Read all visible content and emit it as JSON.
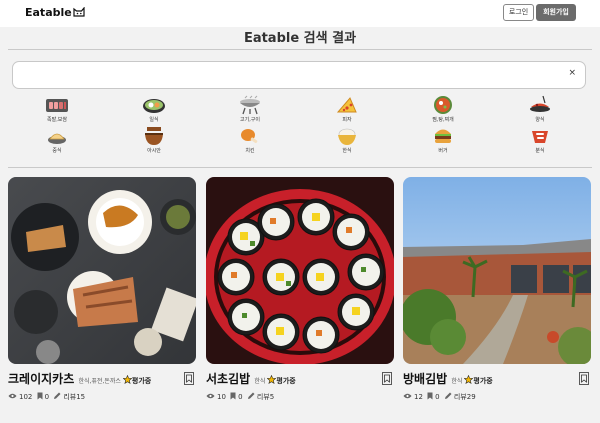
{
  "header": {
    "logo": "Eatable",
    "login_label": "로그인",
    "signup_label": "회원가입"
  },
  "page_title": "Eatable 검색 결과",
  "search": {
    "value": "",
    "placeholder": "",
    "clear_label": "×"
  },
  "categories": [
    {
      "label": "족발,보쌈",
      "icon": "pork-slices-icon"
    },
    {
      "label": "일식",
      "icon": "sushi-icon"
    },
    {
      "label": "고기,구이",
      "icon": "grill-icon"
    },
    {
      "label": "피자",
      "icon": "pizza-icon"
    },
    {
      "label": "찜,탕,찌개",
      "icon": "stew-icon"
    },
    {
      "label": "양식",
      "icon": "pasta-icon"
    },
    {
      "label": "중식",
      "icon": "dumpling-icon"
    },
    {
      "label": "아시안",
      "icon": "noodle-bowl-icon"
    },
    {
      "label": "치킨",
      "icon": "chicken-icon"
    },
    {
      "label": "한식",
      "icon": "rice-bowl-icon"
    },
    {
      "label": "버거",
      "icon": "burger-icon"
    },
    {
      "label": "분식",
      "icon": "tteokbokki-icon"
    }
  ],
  "restaurants": [
    {
      "name": "크레이지카츠",
      "type": "한식,퓨전,돈까스",
      "rating": "평가중",
      "views": "102",
      "bookmarks": "0",
      "reviews": "리뷰15"
    },
    {
      "name": "서초김밥",
      "type": "한식",
      "rating": "평가중",
      "views": "10",
      "bookmarks": "0",
      "reviews": "리뷰5"
    },
    {
      "name": "방배김밥",
      "type": "한식",
      "rating": "평가중",
      "views": "12",
      "bookmarks": "0",
      "reviews": "리뷰29"
    }
  ],
  "colors": {
    "accent": "#6b6b6b",
    "star": "#f2b705",
    "background": "#f2f2f2"
  }
}
